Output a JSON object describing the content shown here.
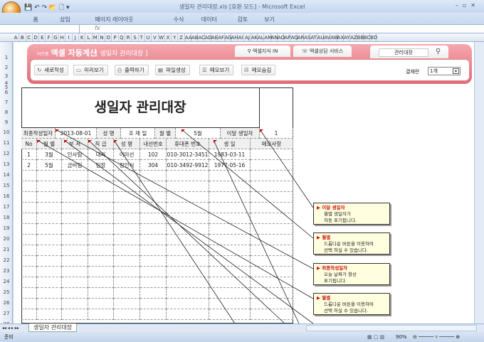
{
  "window": {
    "title": "생일자 관리대장.xls  [호환 모드] - Microsoft Excel"
  },
  "ribbon_tabs": [
    "홈",
    "삽입",
    "페이지 레이아웃",
    "수식",
    "데이터",
    "검토",
    "보기"
  ],
  "formula_bar": {
    "fx": "fx",
    "value": ""
  },
  "columns": [
    "A",
    "B",
    "C",
    "D",
    "E",
    "F",
    "G",
    "H",
    "I",
    "J",
    "K",
    "L",
    "M",
    "N",
    "O",
    "P",
    "Q",
    "R",
    "S",
    "T",
    "U",
    "V",
    "W",
    "X",
    "Y",
    "Z",
    "AA",
    "AB",
    "AC",
    "AD",
    "AE",
    "AF",
    "AG",
    "AH",
    "AI",
    "AJ",
    "AK",
    "AL",
    "AM",
    "AN",
    "AO",
    "AP",
    "AQ",
    "AR",
    "AS",
    "AT",
    "AU",
    "AV",
    "AW",
    "AX",
    "AY",
    "AZ",
    "BB",
    "BC",
    "BD"
  ],
  "banner": {
    "brand_small": "비즈폼",
    "brand": "엑셀 자동계산",
    "subtitle": "[ 생일자 관리대장 ]",
    "tab1": "엑셀지식 IN",
    "tab2": "엑셀상담 서비스",
    "search_value": "관리대장"
  },
  "toolbar": {
    "buttons": [
      {
        "icon": "↻",
        "label": "새로작성"
      },
      {
        "icon": "▭",
        "label": "미리보기"
      },
      {
        "icon": "⎙",
        "label": "출력하기"
      },
      {
        "icon": "▦",
        "label": "파일생성"
      },
      {
        "icon": "☰",
        "label": "메모보기"
      },
      {
        "icon": "☒",
        "label": "메모숨김"
      }
    ],
    "count_label": "결재란",
    "count_value": "1개"
  },
  "sheet": {
    "title": "생일자 관리대장",
    "info": {
      "last_date_label": "최종작성일자",
      "last_date": "2013-08-01",
      "name_label": "성  명",
      "name": "조 재 일",
      "month_label": "월  별",
      "month": "5월",
      "this_month_label": "이달 생일자",
      "this_month_count": "1"
    },
    "headers": [
      "No",
      "월 별",
      "부  서",
      "직  급",
      "성  명",
      "내선번호",
      "휴대폰 번호",
      "생    일",
      "메모사항"
    ],
    "rows": [
      [
        "1",
        "3월",
        "인사팀",
        "대리",
        "이미선",
        "102",
        "010-3012-3451",
        "1983-03-11",
        ""
      ],
      [
        "2",
        "5월",
        "금비팀",
        "팀장",
        "정인식",
        "304",
        "010-3492-9912",
        "1977-05-16",
        ""
      ]
    ]
  },
  "notes": [
    {
      "title": "이달 생일자",
      "body": [
        "월별 생일자가",
        "자동 표기됩니다."
      ]
    },
    {
      "title": "월별",
      "body": [
        "드롭다운 버튼을 이용하여",
        "선택 하실 수 있습니다."
      ]
    },
    {
      "title": "최종작성일자",
      "body": [
        "오늘 날짜가 항상",
        "표기됩니다."
      ]
    },
    {
      "title": "월별",
      "body": [
        "드롭다운 버튼을 이용하여",
        "선택 하실 수 있습니다."
      ]
    }
  ],
  "sheet_tab": "생일자 관리대장",
  "status": {
    "ready": "준비",
    "zoom": "90%"
  }
}
